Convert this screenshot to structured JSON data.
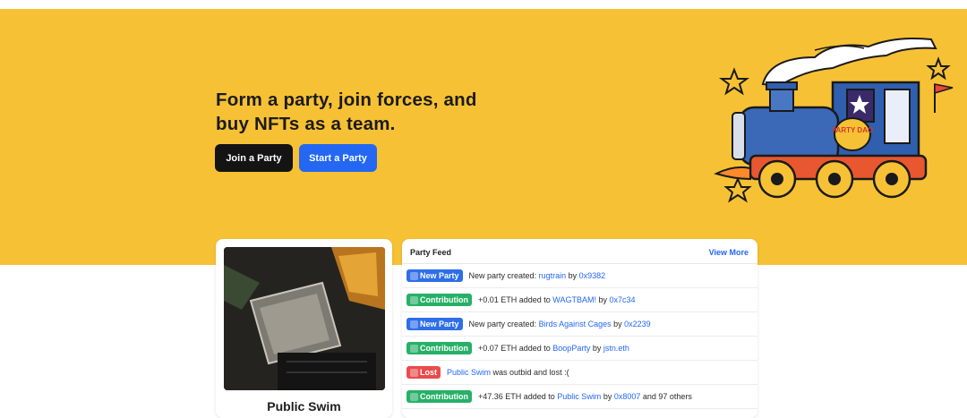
{
  "hero": {
    "headline_line1": "Form a party, join forces, and",
    "headline_line2": "buy NFTs as a team.",
    "join_label": "Join a Party",
    "start_label": "Start a Party",
    "train_sign": "PARTY DAO"
  },
  "card": {
    "title": "Public Swim"
  },
  "feed": {
    "title": "Party Feed",
    "view_more": "View More",
    "rows": [
      {
        "badge": "New Party",
        "type": "new",
        "pre": "New party created: ",
        "link1": "rugtrain",
        "mid": " by ",
        "link2": "0x9382",
        "post": ""
      },
      {
        "badge": "Contribution",
        "type": "contrib",
        "pre": "+0.01 ETH added to ",
        "link1": "WAGTBAM!",
        "mid": " by ",
        "link2": "0x7c34",
        "post": ""
      },
      {
        "badge": "New Party",
        "type": "new",
        "pre": "New party created: ",
        "link1": "Birds Against Cages",
        "mid": " by ",
        "link2": "0x2239",
        "post": ""
      },
      {
        "badge": "Contribution",
        "type": "contrib",
        "pre": "+0.07 ETH added to ",
        "link1": "BoopParty",
        "mid": " by ",
        "link2": "jstn.eth",
        "post": ""
      },
      {
        "badge": "Lost",
        "type": "lost",
        "pre": "",
        "link1": "Public Swim",
        "mid": " was outbid and lost :(",
        "link2": "",
        "post": ""
      },
      {
        "badge": "Contribution",
        "type": "contrib",
        "pre": "+47.36 ETH added to ",
        "link1": "Public Swim",
        "mid": " by ",
        "link2": "0x8007",
        "post": " and 97 others"
      }
    ]
  },
  "colors": {
    "hero_bg": "#f7c135",
    "accent_blue": "#2367f3",
    "contribution_green": "#27b067",
    "lost_red": "#ea4b4b"
  }
}
